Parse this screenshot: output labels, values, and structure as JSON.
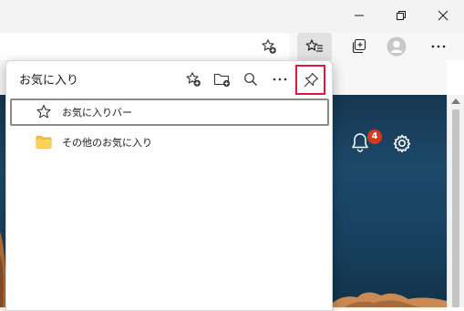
{
  "window": {
    "minimize_icon": "minimize-icon",
    "maximize_icon": "restore-icon",
    "close_icon": "close-icon"
  },
  "toolbar": {
    "add_favorite_icon": "star-add-icon",
    "favorites_icon": "favorites-icon",
    "collections_icon": "collections-icon",
    "profile_icon": "profile-icon",
    "more_icon": "more-icon"
  },
  "favorites_panel": {
    "title": "お気に入り",
    "actions": [
      "star-add-icon",
      "folder-add-icon",
      "search-icon",
      "more-icon",
      "pin-icon"
    ],
    "items": [
      {
        "label": "お気に入りバー",
        "icon": "star-icon",
        "selected": true
      },
      {
        "label": "その他のお気に入り",
        "icon": "folder-icon",
        "selected": false
      }
    ]
  },
  "page": {
    "notification_count": "4",
    "bell_icon": "bell-icon",
    "settings_icon": "gear-icon"
  },
  "colors": {
    "highlight": "#e0173f",
    "badge": "#d33a1d",
    "folder": "#f5c342"
  }
}
